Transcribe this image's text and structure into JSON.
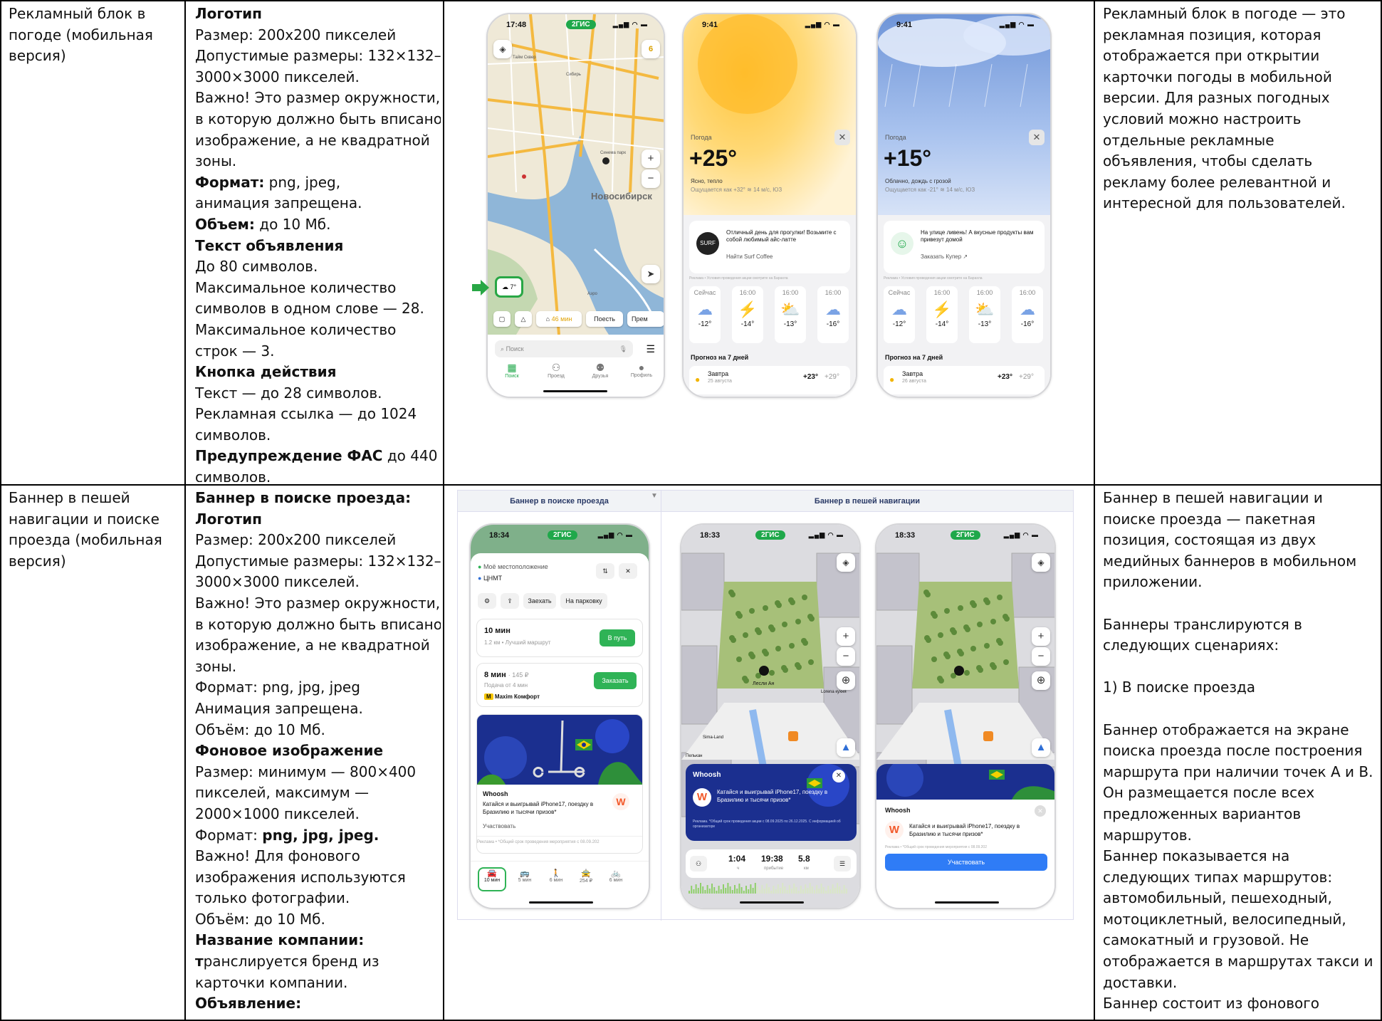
{
  "rows": [
    {
      "col1": [
        "Рекламный блок в",
        "погоде (мобильная",
        "версия)"
      ],
      "col2": [
        {
          "t": "Логотип",
          "b": true
        },
        {
          "t": "Размер: 200х200 пикселей"
        },
        {
          "t": "Допустимые размеры: 132×132–"
        },
        {
          "t": "3000×3000 пикселей."
        },
        {
          "t": "Важно! Это размер окружности,"
        },
        {
          "t": "в которую должно быть вписано"
        },
        {
          "t": "изображение, а не квадратной"
        },
        {
          "t": "зоны."
        },
        {
          "t": "Формат:",
          "b": true,
          "rest": " png, jpeg,"
        },
        {
          "t": "анимация запрещена."
        },
        {
          "t": "Объем:",
          "b": true,
          "rest": " до 10 Мб."
        },
        {
          "t": "Текст объявления",
          "b": true
        },
        {
          "t": "До 80 символов."
        },
        {
          "t": "Максимальное количество"
        },
        {
          "t": "символов в одном слове — 28."
        },
        {
          "t": "Максимальное количество"
        },
        {
          "t": "строк — 3."
        },
        {
          "t": "Кнопка действия",
          "b": true
        },
        {
          "t": "Текст — до 28 символов."
        },
        {
          "t": "Рекламная ссылка — до 1024"
        },
        {
          "t": "символов."
        },
        {
          "t": "Предупреждение ФАС",
          "b": true,
          "rest": " до 440"
        },
        {
          "t": "символов."
        }
      ],
      "col4": [
        "Рекламный блок в погоде — это",
        "рекламная позиция, которая",
        "отображается при открытии",
        "карточки погоды в мобильной",
        "версии. Для разных погодных",
        "условий можно настроить",
        "отдельные рекламные",
        "объявления, чтобы сделать",
        "рекламу более релевантной и",
        "интересной для пользователей."
      ]
    },
    {
      "col1": [
        "Баннер в пешей",
        "навигации и поиске",
        "проезда (мобильная",
        "версия)"
      ],
      "col2": [
        {
          "t": "Баннер в поиске проезда:",
          "b": true
        },
        {
          "t": "Логотип",
          "b": true
        },
        {
          "t": "Размер: 200х200 пикселей"
        },
        {
          "t": "Допустимые размеры: 132×132–"
        },
        {
          "t": "3000×3000 пикселей."
        },
        {
          "t": "Важно! Это размер окружности,"
        },
        {
          "t": "в которую должно быть вписано"
        },
        {
          "t": "изображение, а не квадратной"
        },
        {
          "t": "зоны."
        },
        {
          "t": "Формат: png, jpg, jpeg"
        },
        {
          "t": "Анимация запрещена."
        },
        {
          "t": "Объём: до 10 Мб."
        },
        {
          "t": "Фоновое изображение",
          "b": true
        },
        {
          "t": "Размер: минимум — 800×400"
        },
        {
          "t": "пикселей, максимум —"
        },
        {
          "t": "2000×1000 пикселей."
        },
        {
          "t": "Формат: ",
          "rest2": "png, jpg, jpeg."
        },
        {
          "t": "Важно! Для фонового"
        },
        {
          "t": "изображения используются"
        },
        {
          "t": "только фотографии."
        },
        {
          "t": "Объём: до 10 Мб."
        },
        {
          "t": "Название компании:",
          "b": true
        },
        {
          "t": "т",
          "b": true,
          "rest": "ранслируется бренд из"
        },
        {
          "t": "карточки компании."
        },
        {
          "t": "Объявление:",
          "b": true
        }
      ],
      "col4": [
        "Баннер в пешей навигации и",
        "поиске проезда — пакетная",
        "позиция, состоящая из двух",
        "медийных баннеров в мобильном",
        "приложении.",
        "",
        "Баннеры транслируются в",
        "следующих сценариях:",
        "",
        "1) В поиске проезда",
        "",
        "Баннер отображается на экране",
        "поиска проезда после построения",
        "маршрута при наличии точек А и В.",
        "Он размещается после всех",
        "предложенных вариантов",
        "маршрутов.",
        "Баннер показывается на",
        "следующих типах маршрутов:",
        "автомобильный, пешеходный,",
        "мотоциклетный, велосипедный,",
        "самокатный и грузовой. Не",
        "отображается в маршрутах такси и",
        "доставки.",
        "Баннер состоит из фонового"
      ]
    }
  ],
  "phone1": {
    "time": "17:48",
    "brand": "2ГИС",
    "city": "Новосибирск",
    "weather_chip": "7°",
    "bottom_chips": [
      "46 мин",
      "Поесть",
      "Прем"
    ],
    "search": "Поиск",
    "tabs": [
      "Поиск",
      "Проезд",
      "Друзья",
      "Профиль"
    ],
    "badge": "6",
    "streets": [
      "Тайм Сквер",
      "Сибирь",
      "Синема парк",
      "Аэро"
    ]
  },
  "weather_cards": [
    {
      "time": "9:41",
      "label": "Погода",
      "temp": "+25°",
      "desc": "Ясно, тепло",
      "feels": "Ощущается как +32°  ≋ 14 м/с, ЮЗ",
      "ad_text": "Отличный день для прогулки! Возьмите с собой любимый айс-латте",
      "ad_action": "Найти Surf Coffee",
      "disclaimer": "Реклама • Условия проведения акции смотрите на Барахла",
      "hours": [
        {
          "h": "Сейчас",
          "t": "-12°"
        },
        {
          "h": "16:00",
          "t": "-14°"
        },
        {
          "h": "16:00",
          "t": "-13°"
        },
        {
          "h": "16:00",
          "t": "-16°"
        }
      ],
      "forecast_title": "Прогноз на 7 дней",
      "tomorrow": "Завтра",
      "tomorrow_sub": "25 августа",
      "tomorrow_temp": "+23°",
      "tomorrow_temp2": "+29°"
    },
    {
      "time": "9:41",
      "label": "Погода",
      "temp": "+15°",
      "desc": "Облачно, дождь с грозой",
      "feels": "Ощущается как -21°  ≋ 14 м/с, ЮЗ",
      "ad_text": "На улице ливень! А вкусные продукты вам привезут домой",
      "ad_action": "Заказать Купер ↗",
      "disclaimer": "Реклама • Условия проведения акции смотрите на Барахла",
      "hours": [
        {
          "h": "Сейчас",
          "t": "-12°"
        },
        {
          "h": "16:00",
          "t": "-14°"
        },
        {
          "h": "16:00",
          "t": "-13°"
        },
        {
          "h": "16:00",
          "t": "-16°"
        }
      ],
      "forecast_title": "Прогноз на 7 дней",
      "tomorrow": "Завтра",
      "tomorrow_sub": "26 августа",
      "tomorrow_temp": "+23°",
      "tomorrow_temp2": "+29°"
    }
  ],
  "panel2": {
    "header_left": "Баннер в поиске проезда",
    "header_right": "Баннер в пешей навигации",
    "route": {
      "time": "18:34",
      "brand": "2ГИС",
      "from": "Моё местоположение",
      "to": "ЦНМТ",
      "chips": [
        "Заехать",
        "На парковку"
      ],
      "opt1_title": "10 мин",
      "opt1_sub": "1.2 км • Лучший маршрут",
      "opt1_btn": "В путь",
      "opt2_title": "8 мин",
      "opt2_price": "· 145 ₽",
      "opt2_sub": "Подача от 4 мин",
      "opt2_btn": "Заказать",
      "opt2_brand": "Maxim Комфорт",
      "ad_brand": "Whoosh",
      "ad_text": "Катайся и выигрывай iPhone17, поездку в Бразилию и тысячи призов*",
      "ad_action": "Участвовать",
      "ad_disc": "Реклама • *Общий срок проведения мероприятия с 08.09.202",
      "modes": [
        {
          "l": "10 мин"
        },
        {
          "l": "5 мин"
        },
        {
          "l": "6 мин"
        },
        {
          "l": "254 ₽"
        },
        {
          "l": "6 мин"
        }
      ]
    },
    "nav1": {
      "time": "18:33",
      "brand": "2ГИС",
      "ad_brand": "Whoosh",
      "ad_text": "Катайся и выигрывай iPhone17, поездку в Бразилию и тысячи призов*",
      "ad_disc": "Реклама. *Общий срок проведения акции с 08.09.2025 по 26.12.2025. С информацией об организаторе",
      "eta1": "1:04",
      "eta1_sub": "ч",
      "eta2": "19:38",
      "eta2_sub": "прибытие",
      "eta3": "5.8",
      "eta3_sub": "км",
      "place": "Лесли Ан",
      "place2": "Lorena кухня",
      "place3": "Sima-Land",
      "place4": "Пелькан"
    },
    "nav2": {
      "time": "18:33",
      "brand": "2ГИС",
      "ad_brand": "Whoosh",
      "ad_text": "Катайся и выигрывай iPhone17, поездку в Бразилию и тысячи призов*",
      "ad_disc": "Реклама • *Общий срок проведения мероприятия с 08.09.202",
      "ad_btn": "Участвовать"
    }
  }
}
